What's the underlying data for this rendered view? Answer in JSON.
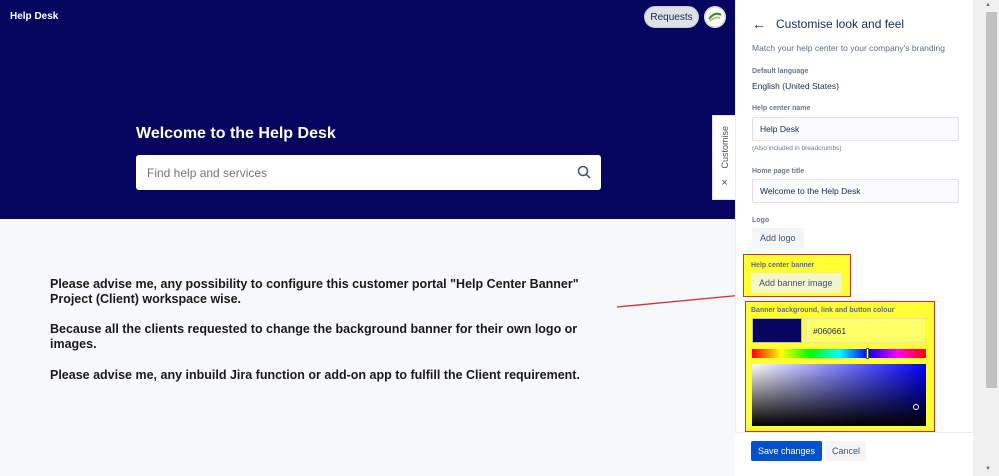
{
  "header": {
    "brand": "Help Desk",
    "requests_label": "Requests"
  },
  "hero": {
    "title": "Welcome to the Help Desk",
    "search_placeholder": "Find help and services"
  },
  "notes": [
    "Please advise me, any possibility to configure this customer portal \"Help Center Banner\" Project (Client) workspace wise.",
    "Because all the clients requested to change the background banner for their own logo or images.",
    "Please advise me, any inbuild Jira function or add-on app to fulfill the Client requirement."
  ],
  "customise_tab": {
    "label": "Customise",
    "close": "×"
  },
  "panel": {
    "title": "Customise look and feel",
    "subtitle": "Match your help center to your company's branding",
    "default_language_label": "Default language",
    "default_language_value": "English (United States)",
    "help_center_name_label": "Help center name",
    "help_center_name_value": "Help Desk",
    "help_center_name_hint": "(Also included in breadcrumbs)",
    "home_page_title_label": "Home page title",
    "home_page_title_value": "Welcome to the Help Desk",
    "logo_label": "Logo",
    "add_logo": "Add logo",
    "banner_label": "Help center banner",
    "add_banner": "Add banner image",
    "colour_label": "Banner background, link and button colour",
    "colour_hex": "#060661",
    "save": "Save changes",
    "cancel": "Cancel"
  },
  "colors": {
    "banner": "#060661",
    "primary_button": "#0052cc",
    "highlight": "#ffff33",
    "annotation": "#cc3333"
  }
}
